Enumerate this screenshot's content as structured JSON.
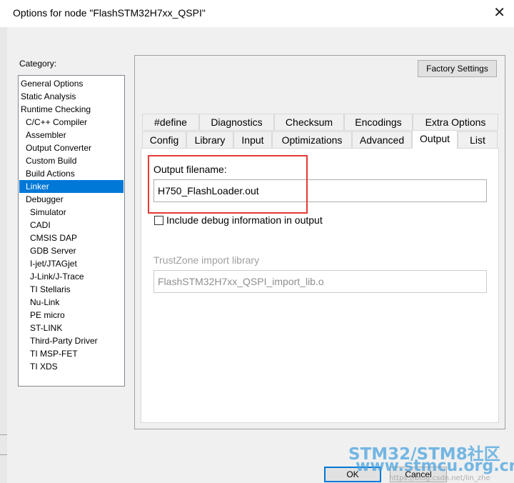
{
  "window": {
    "title": "Options for node \"FlashSTM32H7xx_QSPI\"",
    "close_glyph": "✕"
  },
  "category": {
    "label": "Category:",
    "items": [
      {
        "label": "General Options",
        "level": 0
      },
      {
        "label": "Static Analysis",
        "level": 0
      },
      {
        "label": "Runtime Checking",
        "level": 0
      },
      {
        "label": "C/C++ Compiler",
        "level": 1
      },
      {
        "label": "Assembler",
        "level": 1
      },
      {
        "label": "Output Converter",
        "level": 1
      },
      {
        "label": "Custom Build",
        "level": 1
      },
      {
        "label": "Build Actions",
        "level": 1
      },
      {
        "label": "Linker",
        "level": 1,
        "selected": true
      },
      {
        "label": "Debugger",
        "level": 1
      },
      {
        "label": "Simulator",
        "level": 2
      },
      {
        "label": "CADI",
        "level": 2
      },
      {
        "label": "CMSIS DAP",
        "level": 2
      },
      {
        "label": "GDB Server",
        "level": 2
      },
      {
        "label": "I-jet/JTAGjet",
        "level": 2
      },
      {
        "label": "J-Link/J-Trace",
        "level": 2
      },
      {
        "label": "TI Stellaris",
        "level": 2
      },
      {
        "label": "Nu-Link",
        "level": 2
      },
      {
        "label": "PE micro",
        "level": 2
      },
      {
        "label": "ST-LINK",
        "level": 2
      },
      {
        "label": "Third-Party Driver",
        "level": 2
      },
      {
        "label": "TI MSP-FET",
        "level": 2
      },
      {
        "label": "TI XDS",
        "level": 2
      }
    ]
  },
  "factory_settings_label": "Factory Settings",
  "tabs_row1": [
    "#define",
    "Diagnostics",
    "Checksum",
    "Encodings",
    "Extra Options"
  ],
  "tabs_row2": [
    "Config",
    "Library",
    "Input",
    "Optimizations",
    "Advanced",
    "Output",
    "List"
  ],
  "active_tab": "Output",
  "output": {
    "filename_label": "Output filename:",
    "filename_value": "H750_FlashLoader.out",
    "include_debug_label": "Include debug information in output",
    "include_debug_checked": false,
    "trustzone_label": "TrustZone import library",
    "trustzone_value": "FlashSTM32H7xx_QSPI_import_lib.o"
  },
  "buttons": {
    "ok": "OK",
    "cancel": "Cancel"
  },
  "watermark": {
    "line1": "STM32/STM8社区",
    "line2": "www.stmcu.org.cn",
    "line3": "https://blog.csdn.net/lin_zhe"
  },
  "colors": {
    "selection": "#0078d7",
    "highlight_box": "#e53935",
    "watermark": "#4aa3df"
  }
}
